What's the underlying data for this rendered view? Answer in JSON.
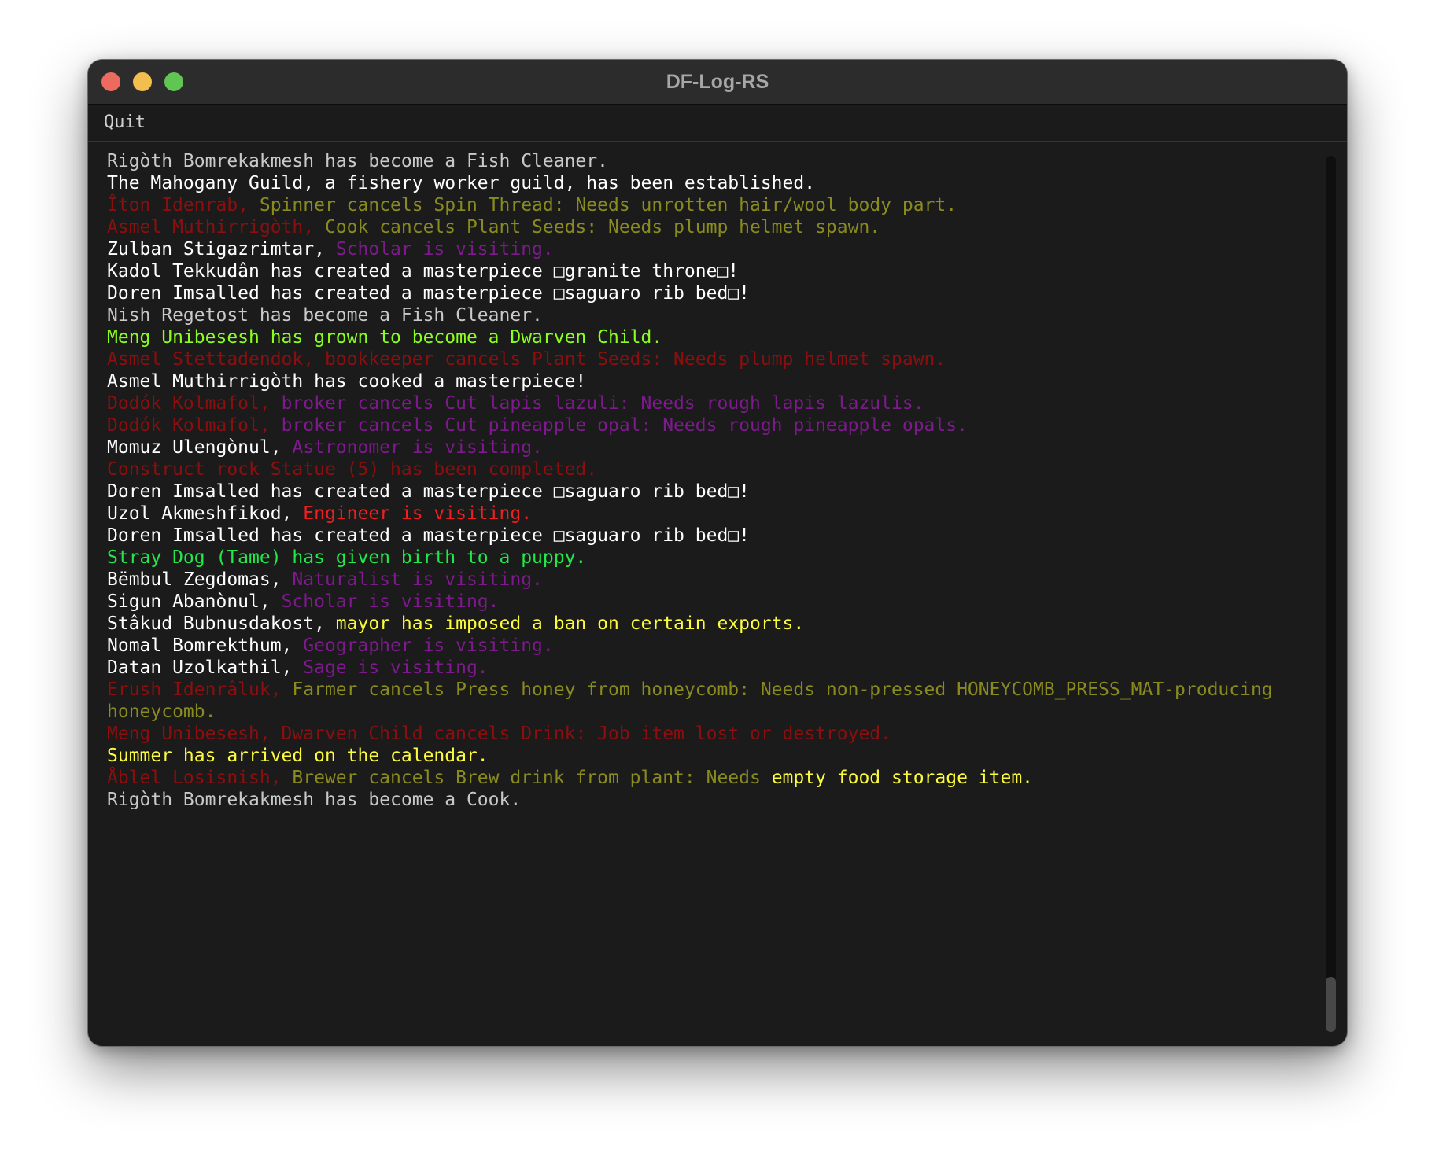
{
  "colors": {
    "window_bg": "#1b1b1b",
    "titlebar_bg": "#2c2c2c",
    "title_text": "#a6a6a6",
    "menu_text": "#d0d0d0",
    "close": "#ed6a5e",
    "minimize": "#f4be4f",
    "maximize": "#61c554",
    "grey": "#c9c9c9",
    "white": "#ffffff",
    "red_dark": "#8b0f0f",
    "olive": "#898b1e",
    "magenta": "#7e1a8e",
    "lime": "#8aff1f",
    "red": "#f12020",
    "green": "#22e84a",
    "yellow": "#fcfc3d"
  },
  "window": {
    "title": "DF-Log-RS",
    "controls": {
      "close": "close-button",
      "minimize": "minimize-button",
      "maximize": "maximize-button"
    }
  },
  "menu": {
    "quit": "Quit"
  },
  "log": [
    [
      {
        "t": "Rigòth Bomrekakmesh has become a Fish Cleaner.",
        "c": "grey"
      }
    ],
    [
      {
        "t": "The Mahogany Guild, a fishery worker guild, has been established.",
        "c": "white"
      }
    ],
    [
      {
        "t": "Îton Idenrab, ",
        "c": "red_dark"
      },
      {
        "t": "Spinner cancels Spin Thread: Needs unrotten hair/wool body part.",
        "c": "olive"
      }
    ],
    [
      {
        "t": "Asmel Muthirrigòth, ",
        "c": "red_dark"
      },
      {
        "t": "Cook cancels Plant Seeds: Needs plump helmet spawn.",
        "c": "olive"
      }
    ],
    [
      {
        "t": "Zulban Stigazrimtar, ",
        "c": "white"
      },
      {
        "t": "Scholar is visiting.",
        "c": "magenta"
      }
    ],
    [
      {
        "t": "Kadol Tekkudân has created a masterpiece □granite throne□!",
        "c": "white"
      }
    ],
    [
      {
        "t": "Doren Imsalled has created a masterpiece □saguaro rib bed□!",
        "c": "white"
      }
    ],
    [
      {
        "t": "Nish Regetost has become a Fish Cleaner.",
        "c": "grey"
      }
    ],
    [
      {
        "t": "Meng Unibesesh has grown to become a Dwarven Child.",
        "c": "lime"
      }
    ],
    [
      {
        "t": "Asmel Stettadendok, bookkeeper cancels Plant Seeds: Needs plump helmet spawn.",
        "c": "red_dark"
      }
    ],
    [
      {
        "t": "Asmel Muthirrigòth has cooked a masterpiece!",
        "c": "white"
      }
    ],
    [
      {
        "t": "Dodók Kolmafol, ",
        "c": "red_dark"
      },
      {
        "t": "broker cancels Cut lapis lazuli: Needs rough lapis lazulis.",
        "c": "magenta"
      }
    ],
    [
      {
        "t": "Dodók Kolmafol, ",
        "c": "red_dark"
      },
      {
        "t": "broker cancels Cut pineapple opal: Needs rough pineapple opals.",
        "c": "magenta"
      }
    ],
    [
      {
        "t": "Momuz Ulengònul, ",
        "c": "white"
      },
      {
        "t": "Astronomer is visiting.",
        "c": "magenta"
      }
    ],
    [
      {
        "t": "Construct rock Statue (5) has been completed.",
        "c": "red_dark"
      }
    ],
    [
      {
        "t": "Doren Imsalled has created a masterpiece □saguaro rib bed□!",
        "c": "white"
      }
    ],
    [
      {
        "t": "Uzol Akmeshfikod, ",
        "c": "white"
      },
      {
        "t": "Engineer is visiting.",
        "c": "red"
      }
    ],
    [
      {
        "t": "Doren Imsalled has created a masterpiece □saguaro rib bed□!",
        "c": "white"
      }
    ],
    [
      {
        "t": "Stray Dog (Tame) has given birth to a puppy.",
        "c": "green"
      }
    ],
    [
      {
        "t": "Bëmbul Zegdomas, ",
        "c": "white"
      },
      {
        "t": "Naturalist is visiting.",
        "c": "magenta"
      }
    ],
    [
      {
        "t": "Sigun Abanònul, ",
        "c": "white"
      },
      {
        "t": "Scholar is visiting.",
        "c": "magenta"
      }
    ],
    [
      {
        "t": "Stâkud Bubnusdakost, ",
        "c": "white"
      },
      {
        "t": "mayor has imposed a ban on certain exports.",
        "c": "yellow"
      }
    ],
    [
      {
        "t": "Nomal Bomrekthum, ",
        "c": "white"
      },
      {
        "t": "Geographer is visiting.",
        "c": "magenta"
      }
    ],
    [
      {
        "t": "Datan Uzolkathil, ",
        "c": "white"
      },
      {
        "t": "Sage is visiting.",
        "c": "magenta"
      }
    ],
    [
      {
        "t": "Erush Idenrâluk, ",
        "c": "red_dark"
      },
      {
        "t": "Farmer cancels Press honey from honeycomb: Needs non-pressed HONEYCOMB_PRESS_MAT-producing",
        "c": "olive"
      }
    ],
    [
      {
        "t": "honeycomb.",
        "c": "olive"
      }
    ],
    [
      {
        "t": "Meng Unibesesh, Dwarven Child cancels Drink: Job item lost or destroyed.",
        "c": "red_dark"
      }
    ],
    [
      {
        "t": "Summer has arrived on the calendar.",
        "c": "yellow"
      }
    ],
    [
      {
        "t": "Åblel Losisnish, ",
        "c": "red_dark"
      },
      {
        "t": "Brewer cancels Brew drink from plant: Needs ",
        "c": "olive"
      },
      {
        "t": "empty food storage item.",
        "c": "yellow"
      }
    ],
    [
      {
        "t": "Rigòth Bomrekakmesh has become a Cook.",
        "c": "grey"
      }
    ]
  ]
}
